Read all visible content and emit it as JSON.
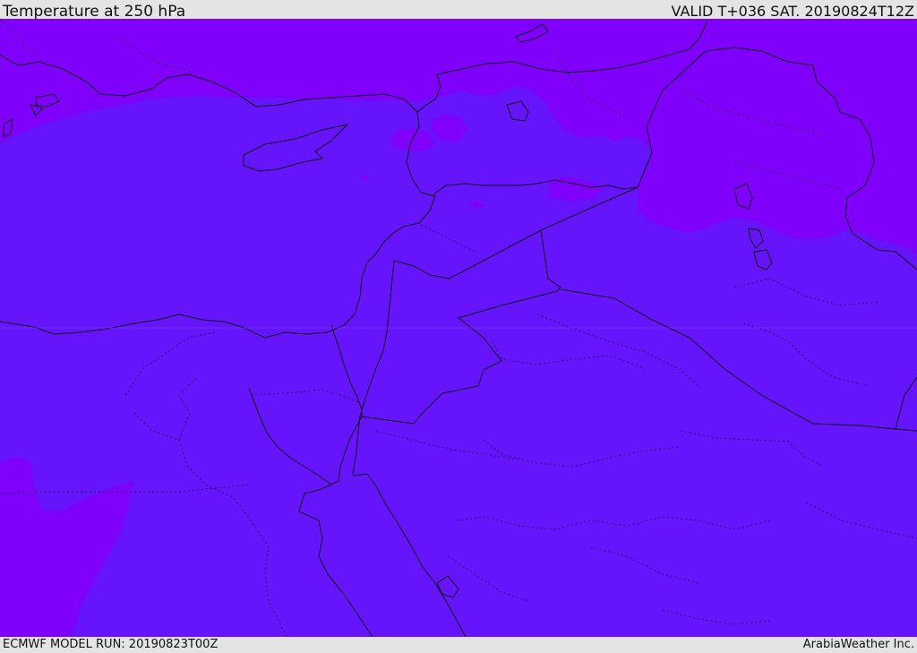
{
  "header": {
    "title": "Temperature at 250 hPa",
    "valid": "VALID T+036 SAT. 20190824T12Z"
  },
  "footer": {
    "model_run": "ECMWF MODEL RUN: 20190823T00Z",
    "credit": "ArabiaWeather Inc."
  },
  "colors": {
    "field_main": "#6614fb",
    "field_cold": "#7f00fb",
    "border": "#111111"
  }
}
